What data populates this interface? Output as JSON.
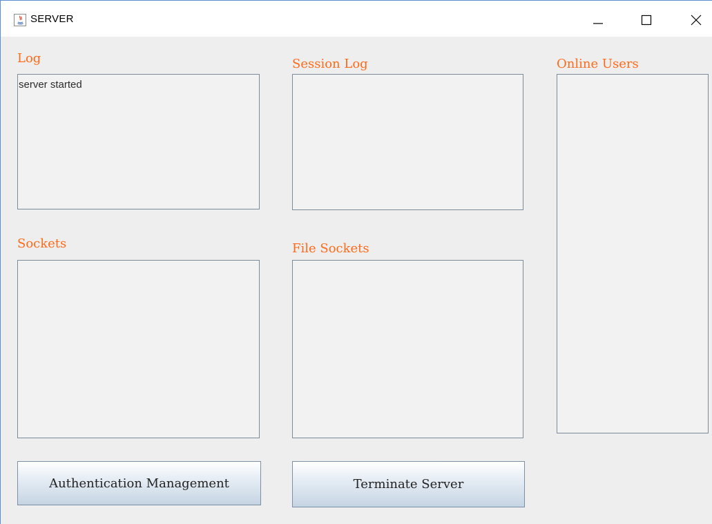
{
  "window": {
    "title": "SERVER",
    "icon": "java-app-icon",
    "controls": [
      "minimize-icon",
      "maximize-icon",
      "close-icon"
    ]
  },
  "panels": {
    "log": {
      "label": "Log",
      "content": "server started"
    },
    "session_log": {
      "label": "Session Log",
      "content": ""
    },
    "online_users": {
      "label": "Online Users",
      "content": ""
    },
    "sockets": {
      "label": "Sockets",
      "content": ""
    },
    "file_sockets": {
      "label": "File Sockets",
      "content": ""
    }
  },
  "buttons": {
    "auth_management": "Authentication Management",
    "terminate_server": "Terminate Server"
  },
  "colors": {
    "label_accent": "#ff6a1a",
    "window_border": "#5a8fd6",
    "client_background": "#eeeeee"
  }
}
